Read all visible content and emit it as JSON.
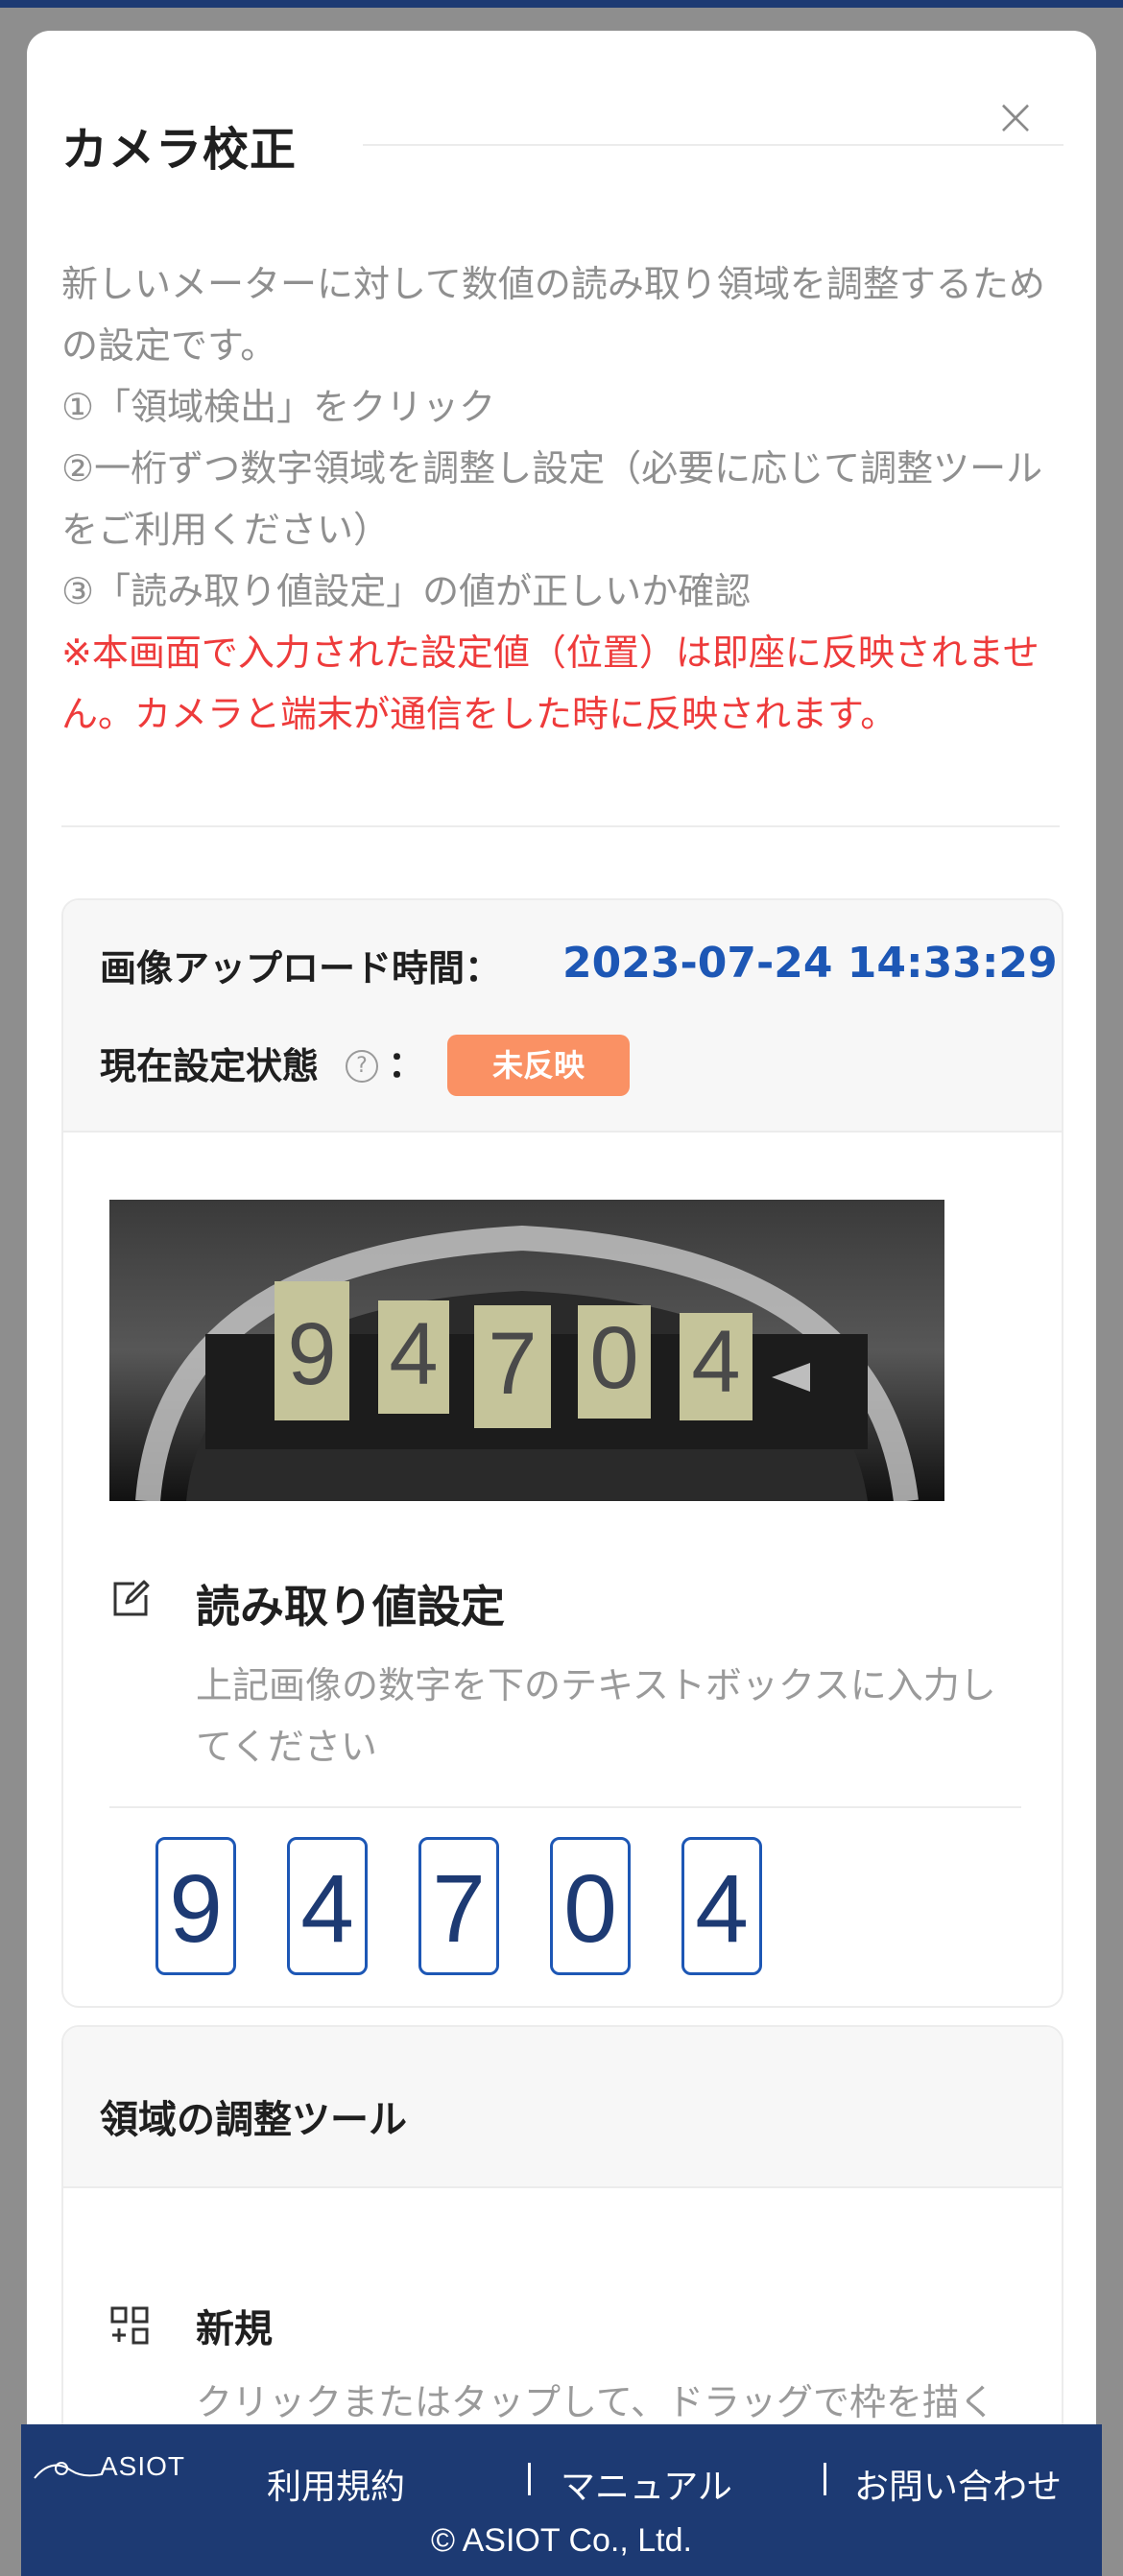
{
  "modal": {
    "title": "カメラ校正",
    "close_label": "×"
  },
  "description": {
    "lines": [
      "新しいメーターに対して数値の読み取り領域を調整するための設定です。",
      "①「領域検出」をクリック",
      "②一桁ずつ数字領域を調整し設定（必要に応じて調整ツールをご利用ください）",
      "③「読み取り値設定」の値が正しいか確認"
    ],
    "warning": "※本画面で入力された設定値（位置）は即座に反映されません。カメラと端末が通信をした時に反映されます。"
  },
  "status": {
    "upload_label": "画像アップロード時間：",
    "upload_time": "2023-07-24 14:33:29",
    "state_label": "現在設定状態",
    "colon": "：",
    "state_badge": "未反映",
    "help_icon": "question-circle-icon"
  },
  "meter_image": {
    "digits_shown": [
      "9",
      "4",
      "7",
      "0",
      "4"
    ]
  },
  "reading": {
    "title": "読み取り値設定",
    "subtitle": "上記画像の数字を下のテキストボックスに入力してください",
    "values": [
      "9",
      "4",
      "7",
      "0",
      "4"
    ],
    "icon": "edit-icon"
  },
  "adjust_tool": {
    "title": "領域の調整ツール",
    "new_label": "新規",
    "new_description": "クリックまたはタップして、ドラッグで枠を描く",
    "icon": "add-region-icon"
  },
  "footer": {
    "logo_text": "ASIOT",
    "links": [
      "利用規約",
      "マニュアル",
      "お問い合わせ"
    ],
    "copyright": "© ASIOT Co., Ltd."
  },
  "colors": {
    "brand_navy": "#1d3a73",
    "accent_blue": "#1d57b5",
    "warning_red": "#ee3b3b",
    "badge_orange": "#fa9164"
  }
}
